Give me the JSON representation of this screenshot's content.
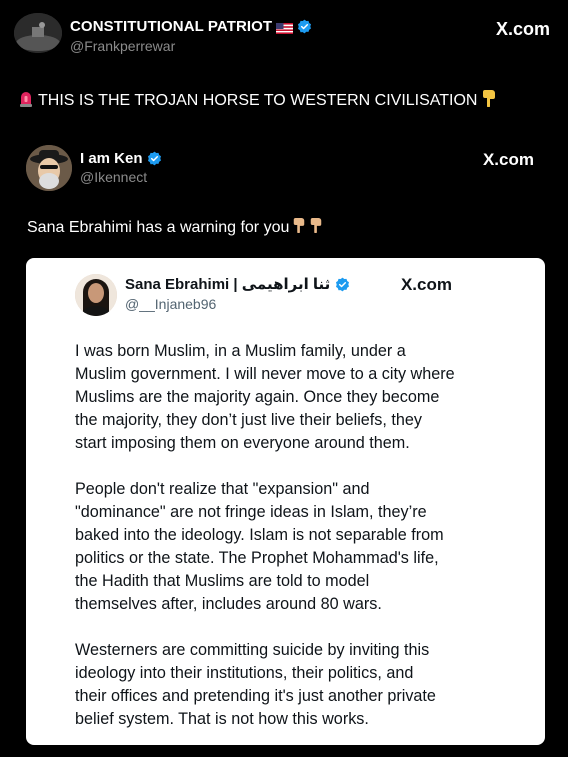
{
  "outer_post": {
    "display_name": "CONSTITUTIONAL PATRIOT",
    "handle": "@Frankperrewar",
    "source": "X.com",
    "headline": "THIS IS THE TROJAN HORSE TO WESTERN CIVILISATION"
  },
  "quoted_post": {
    "display_name": "I am Ken",
    "handle": "@Ikennect",
    "source": "X.com",
    "text": "Sana Ebrahimi has a warning for you"
  },
  "card": {
    "display_name": "Sana Ebrahimi | ثنا ابراهیمی",
    "handle": "@__Injaneb96",
    "source": "X.com",
    "paragraphs": [
      {
        "lines": [
          "I was born Muslim, in a Muslim family, under a",
          "Muslim government. I will never move to a city where",
          "Muslims are the majority again. Once they become",
          "the majority, they don’t just live their beliefs, they",
          "start imposing them on everyone around them."
        ]
      },
      {
        "lines": [
          "People don't realize that \"expansion\" and",
          "\"dominance\" are not fringe ideas in Islam, they’re",
          "baked into the ideology. Islam is not separable from",
          "politics or the state. The Prophet Mohammad's life,",
          "the Hadith that Muslims are told to model",
          "themselves after, includes around 80 wars."
        ]
      },
      {
        "lines": [
          "Westerners are committing suicide by inviting this",
          "ideology into their institutions, their politics, and",
          "their offices and pretending it's just another private",
          "belief system. That is not how this works."
        ]
      }
    ]
  },
  "icons": {
    "verified": "verified-badge-icon",
    "flag": "us-flag-icon",
    "siren": "siren-icon",
    "pointing_down": "pointing-down-hand-icon"
  },
  "colors": {
    "background": "#000000",
    "verified_blue": "#1d9bf0",
    "handle_gray": "#8b8b8b",
    "card_background": "#ffffff"
  }
}
